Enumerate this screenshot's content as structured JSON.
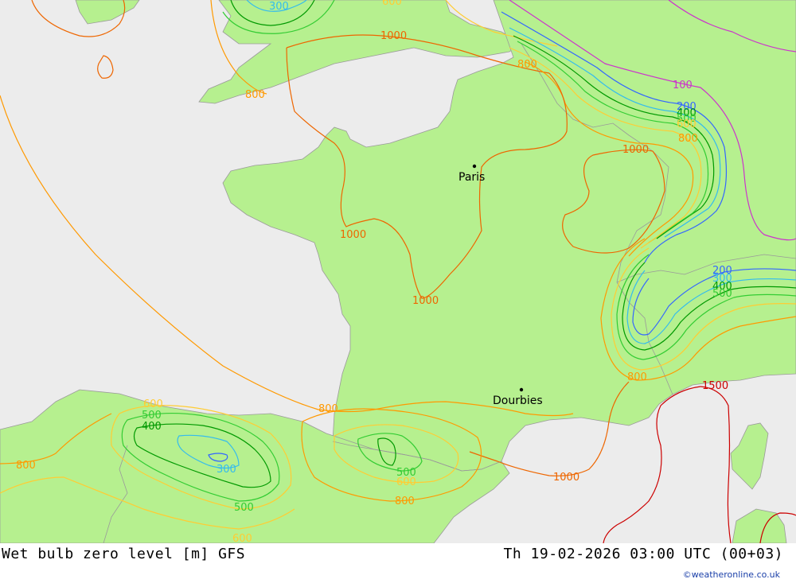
{
  "footer": {
    "title": "Wet bulb zero level [m] GFS",
    "datetime": "Th 19-02-2026 03:00 UTC (00+03)",
    "credit": "©weatheronline.co.uk"
  },
  "colors": {
    "sea": "#ececec",
    "land": "#b6f08f",
    "border": "#9a9a9a",
    "c100": "#cc33cc",
    "c200": "#3366ff",
    "c300": "#33bbee",
    "c400": "#009900",
    "c500": "#33cc33",
    "c600": "#ffcc33",
    "c800": "#ff9900",
    "c1000": "#ee6600",
    "c1500": "#cc0000"
  },
  "cities": [
    {
      "name": "Paris"
    },
    {
      "name": "Dourbies"
    }
  ],
  "contour_labels": {
    "l300_uk": "300",
    "l600_uk": "600",
    "l1000_uk": "1000",
    "l800_wales": "800",
    "l800_lux": "800",
    "l100_east": "100",
    "l200_east": "200",
    "l400_east": "400",
    "l500_east": "500",
    "l600_east": "600",
    "l800_east": "800",
    "l1000_east": "1000",
    "l1000_w": "1000",
    "l1000_c": "1000",
    "l200_alps": "200",
    "l300_alps": "300",
    "l400_alps": "400",
    "l500_alps": "500",
    "l800_alps": "800",
    "l1500": "1500",
    "l800_biscay": "800",
    "l600_sp": "600",
    "l500_sp": "500",
    "l400_sp": "400",
    "l300_sp": "300",
    "l500_sp2": "500",
    "l600_sp2": "600",
    "l800_sp": "800",
    "l500_pyr": "500",
    "l600_pyr": "600",
    "l800_pyr": "800",
    "l1000_med": "1000"
  }
}
